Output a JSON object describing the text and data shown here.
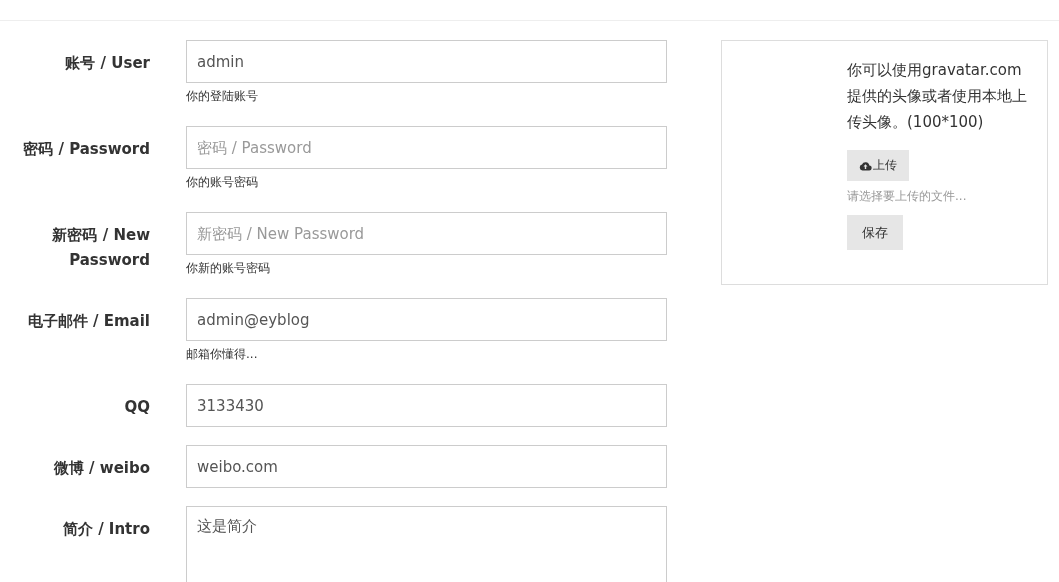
{
  "form": {
    "fields": [
      {
        "kind": "input",
        "label": "账号 / User",
        "value": "admin",
        "help": "你的登陆账号"
      },
      {
        "kind": "input",
        "label": "密码 / Password",
        "placeholder": "密码 / Password",
        "help": "你的账号密码"
      },
      {
        "kind": "input",
        "label": "新密码 / New Password",
        "placeholder": "新密码 / New Password",
        "help": "你新的账号密码"
      },
      {
        "kind": "input",
        "label": "电子邮件 / Email",
        "value": "admin@eyblog",
        "help": "邮箱你懂得..."
      },
      {
        "kind": "input",
        "label": "QQ",
        "value": "3133430"
      },
      {
        "kind": "input",
        "label": "微博 / weibo",
        "value": "weibo.com"
      },
      {
        "kind": "textarea",
        "label": "简介 / Intro",
        "value": "这是简介"
      }
    ]
  },
  "avatar_panel": {
    "description": "你可以使用gravatar.com提供的头像或者使用本地上传头像。(100*100)",
    "upload_button": "上传",
    "file_hint": "请选择要上传的文件...",
    "save_button": "保存"
  }
}
